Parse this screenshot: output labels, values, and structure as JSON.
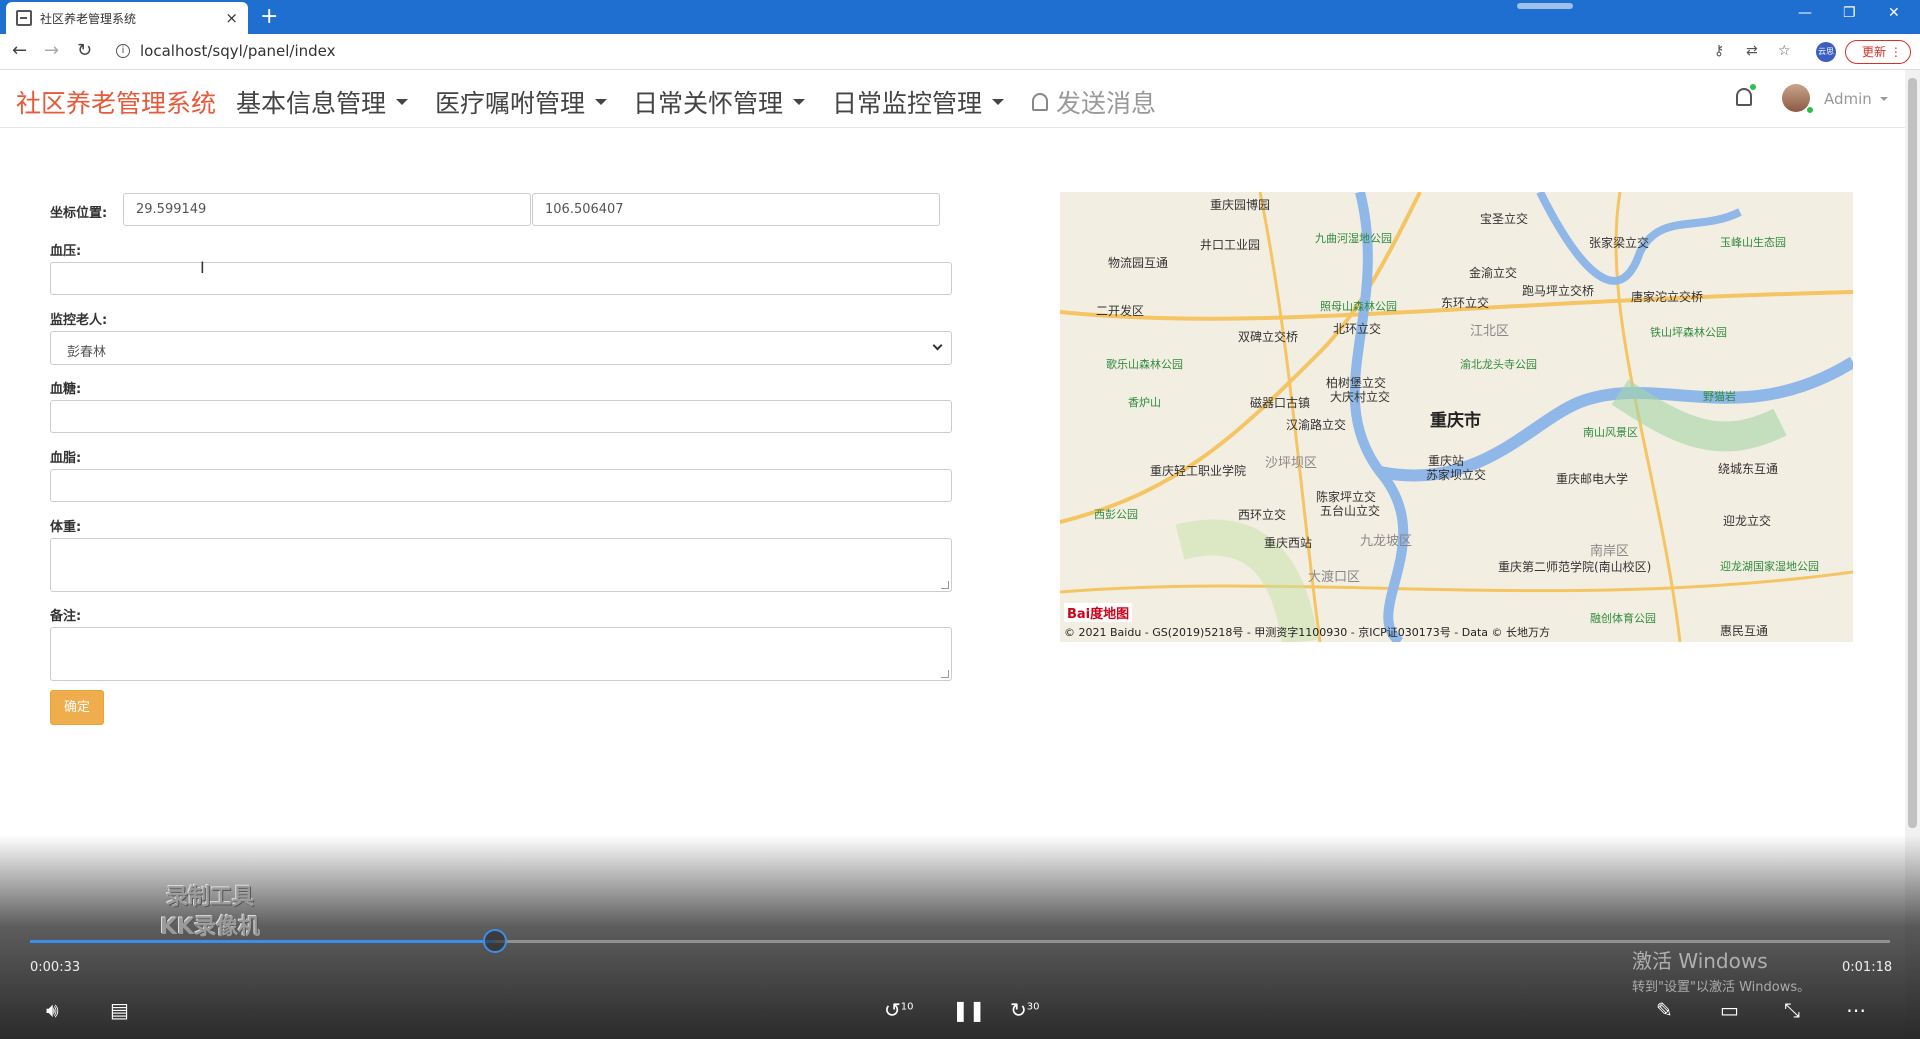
{
  "browser": {
    "tab_title": "社区养老管理系统",
    "tab_close": "×",
    "new_tab": "+",
    "url": "localhost/sqyl/panel/index",
    "profile_label": "云思",
    "update_label": "更新"
  },
  "navbar": {
    "brand": "社区养老管理系统",
    "menus": [
      "基本信息管理",
      "医疗嘱咐管理",
      "日常关怀管理",
      "日常监控管理"
    ],
    "send_message": "发送消息",
    "user": "Admin"
  },
  "form": {
    "coord_label": "坐标位置:",
    "latitude": "29.599149",
    "longitude": "106.506407",
    "blood_pressure_label": "血压:",
    "elder_label": "监控老人:",
    "elder_selected": "彭春林",
    "blood_sugar_label": "血糖:",
    "blood_lipid_label": "血脂:",
    "weight_label": "体重:",
    "remark_label": "备注:",
    "submit_label": "确定"
  },
  "map": {
    "city": "重庆市",
    "labels": [
      "重庆园博园",
      "宝圣立交",
      "九曲河湿地公园",
      "井口工业园",
      "张家梁立交",
      "玉峰山生态园",
      "物流园互通",
      "金渝立交",
      "照母山森林公园",
      "东环立交",
      "跑马坪立交桥",
      "唐家沱立交桥",
      "二开发区",
      "双碑立交桥",
      "北环立交",
      "江北区",
      "铁山坪森林公园",
      "歌乐山森林公园",
      "渝北龙头寺公园",
      "柏树堡立交",
      "大庆村立交",
      "磁器口古镇",
      "香炉山",
      "汉渝路立交",
      "重庆市",
      "南山风景区",
      "野猫岩",
      "沙坪坝区",
      "重庆站",
      "苏家坝立交",
      "重庆轻工职业学院",
      "重庆邮电大学",
      "绕城东互通",
      "陈家坪立交",
      "五台山立交",
      "西彭公园",
      "西环立交",
      "九龙坡区",
      "重庆西站",
      "迎龙立交",
      "南岸区",
      "大渡口区",
      "重庆第二师范学院(南山校区)",
      "迎龙湖国家湿地公园",
      "融创体育公园",
      "惠民互通"
    ],
    "baidu_logo": "Bai度地图",
    "copyright": "© 2021 Baidu - GS(2019)5218号 - 甲测资字1100930 - 京ICP证030173号 - Data © 长地万方"
  },
  "video": {
    "watermark_line1": "录制工具",
    "watermark_line2": "KK录像机",
    "elapsed": "0:00:33",
    "duration": "0:01:18",
    "progress": 0.25,
    "rewind_label": "10",
    "forward_label": "30",
    "activate_title": "激活 Windows",
    "activate_sub": "转到\"设置\"以激活 Windows。"
  }
}
